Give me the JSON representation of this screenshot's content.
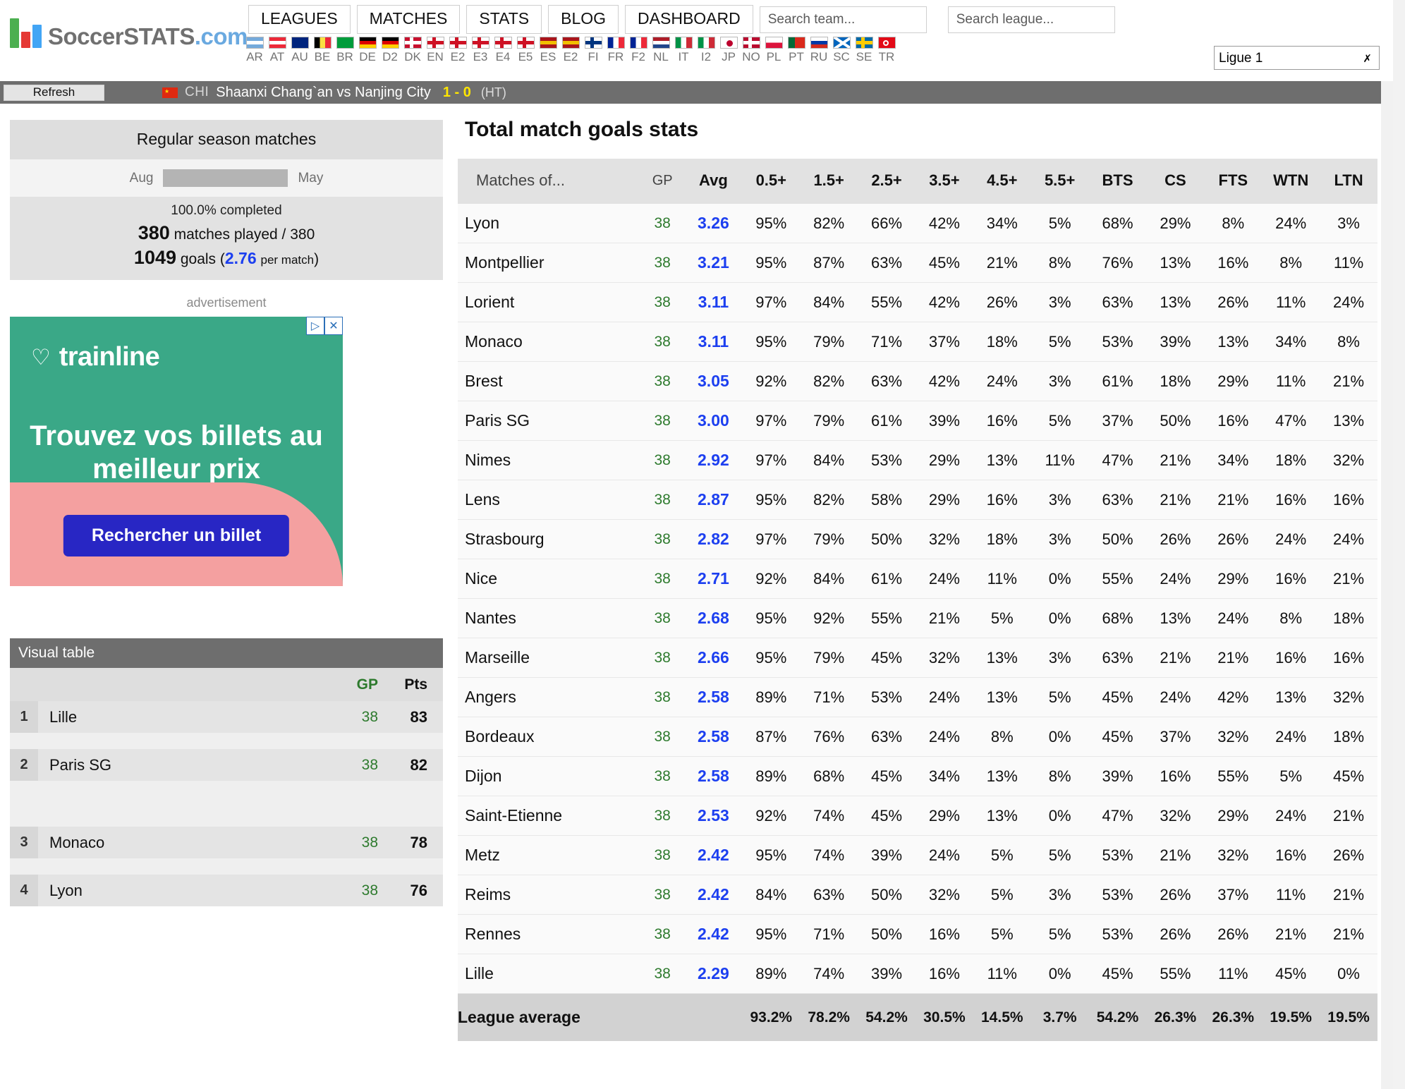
{
  "site": {
    "name_main": "SoccerSTATS",
    "name_suffix": ".com"
  },
  "nav": {
    "buttons": [
      "LEAGUES",
      "MATCHES",
      "STATS",
      "BLOG",
      "DASHBOARD"
    ],
    "search_team_placeholder": "Search team...",
    "search_league_placeholder": "Search league...",
    "search_team_value": "",
    "search_league_value": "",
    "league_selected": "Ligue 1",
    "league_options": [
      "Ligue 1"
    ]
  },
  "flags": [
    {
      "code": "AR",
      "colors": [
        "#75aadb",
        "#ffffff",
        "#75aadb"
      ],
      "dir": "h"
    },
    {
      "code": "AT",
      "colors": [
        "#ed2939",
        "#ffffff",
        "#ed2939"
      ],
      "dir": "h"
    },
    {
      "code": "AU",
      "colors": [
        "#00247d",
        "#00247d",
        "#00247d"
      ],
      "dir": "h"
    },
    {
      "code": "BE",
      "colors": [
        "#000000",
        "#fae042",
        "#ed2939"
      ],
      "dir": "v"
    },
    {
      "code": "BR",
      "colors": [
        "#009c3b",
        "#009c3b",
        "#009c3b"
      ],
      "dir": "h"
    },
    {
      "code": "DE",
      "colors": [
        "#000000",
        "#dd0000",
        "#ffce00"
      ],
      "dir": "h"
    },
    {
      "code": "D2",
      "colors": [
        "#000000",
        "#dd0000",
        "#ffce00"
      ],
      "dir": "h"
    },
    {
      "code": "DK",
      "colors": [
        "#c8102e",
        "#ffffff",
        "#c8102e"
      ],
      "dir": "cross"
    },
    {
      "code": "EN",
      "colors": [
        "#ffffff",
        "#ce1124",
        "#ffffff"
      ],
      "dir": "cross"
    },
    {
      "code": "E2",
      "colors": [
        "#ffffff",
        "#ce1124",
        "#ffffff"
      ],
      "dir": "cross"
    },
    {
      "code": "E3",
      "colors": [
        "#ffffff",
        "#ce1124",
        "#ffffff"
      ],
      "dir": "cross"
    },
    {
      "code": "E4",
      "colors": [
        "#ffffff",
        "#ce1124",
        "#ffffff"
      ],
      "dir": "cross"
    },
    {
      "code": "E5",
      "colors": [
        "#ffffff",
        "#ce1124",
        "#ffffff"
      ],
      "dir": "cross"
    },
    {
      "code": "ES",
      "colors": [
        "#aa151b",
        "#f1bf00",
        "#aa151b"
      ],
      "dir": "h"
    },
    {
      "code": "E2",
      "colors": [
        "#aa151b",
        "#f1bf00",
        "#aa151b"
      ],
      "dir": "h"
    },
    {
      "code": "FI",
      "colors": [
        "#ffffff",
        "#003580",
        "#ffffff"
      ],
      "dir": "cross"
    },
    {
      "code": "FR",
      "colors": [
        "#002395",
        "#ffffff",
        "#ed2939"
      ],
      "dir": "v"
    },
    {
      "code": "F2",
      "colors": [
        "#002395",
        "#ffffff",
        "#ed2939"
      ],
      "dir": "v"
    },
    {
      "code": "NL",
      "colors": [
        "#ae1c28",
        "#ffffff",
        "#21468b"
      ],
      "dir": "h"
    },
    {
      "code": "IT",
      "colors": [
        "#009246",
        "#ffffff",
        "#ce2b37"
      ],
      "dir": "v"
    },
    {
      "code": "I2",
      "colors": [
        "#009246",
        "#ffffff",
        "#ce2b37"
      ],
      "dir": "v"
    },
    {
      "code": "JP",
      "colors": [
        "#ffffff",
        "#bc002d",
        "#ffffff"
      ],
      "dir": "circle"
    },
    {
      "code": "NO",
      "colors": [
        "#ba0c2f",
        "#ffffff",
        "#00205b"
      ],
      "dir": "cross"
    },
    {
      "code": "PL",
      "colors": [
        "#ffffff",
        "#ffffff",
        "#dc143c"
      ],
      "dir": "h2"
    },
    {
      "code": "PT",
      "colors": [
        "#046a38",
        "#da291c",
        "#da291c"
      ],
      "dir": "v2"
    },
    {
      "code": "RU",
      "colors": [
        "#ffffff",
        "#0039a6",
        "#d52b1e"
      ],
      "dir": "h"
    },
    {
      "code": "SC",
      "colors": [
        "#0065bd",
        "#ffffff",
        "#0065bd"
      ],
      "dir": "saltire"
    },
    {
      "code": "SE",
      "colors": [
        "#006aa7",
        "#fecc00",
        "#006aa7"
      ],
      "dir": "cross"
    },
    {
      "code": "TR",
      "colors": [
        "#e30a17",
        "#ffffff",
        "#e30a17"
      ],
      "dir": "circle2"
    }
  ],
  "ticker": {
    "refresh_label": "Refresh",
    "country_code": "CHI",
    "match": "Shaanxi Chang`an vs Nanjing City",
    "score": "1 - 0",
    "period": "(HT)"
  },
  "season": {
    "title": "Regular season matches",
    "start_month": "Aug",
    "end_month": "May",
    "completed": "100.0% completed",
    "matches_played": "380",
    "matches_played_label": "matches played /",
    "matches_total": "380",
    "goals": "1049",
    "goals_label": "goals (",
    "goals_per_match": "2.76",
    "goals_per_match_label": "per match",
    "goals_close": ")"
  },
  "advert": {
    "label": "advertisement",
    "brand": "trainline",
    "headline": "Trouvez vos billets au meilleur prix",
    "cta": "Rechercher un billet",
    "info_icon": "▷",
    "close_icon": "✕"
  },
  "visual_table": {
    "title": "Visual table",
    "columns": {
      "gp": "GP",
      "pts": "Pts"
    },
    "rows": [
      {
        "rank": "1",
        "team": "Lille",
        "gp": "38",
        "pts": "83"
      },
      {
        "rank": "2",
        "team": "Paris SG",
        "gp": "38",
        "pts": "82"
      },
      {
        "rank": "3",
        "team": "Monaco",
        "gp": "38",
        "pts": "78"
      },
      {
        "rank": "4",
        "team": "Lyon",
        "gp": "38",
        "pts": "76"
      }
    ]
  },
  "main": {
    "title": "Total match goals stats",
    "columns": [
      "Matches of...",
      "GP",
      "Avg",
      "0.5+",
      "1.5+",
      "2.5+",
      "3.5+",
      "4.5+",
      "5.5+",
      "BTS",
      "CS",
      "FTS",
      "WTN",
      "LTN"
    ],
    "average_label": "League average"
  },
  "chart_data": {
    "type": "table",
    "title": "Total match goals stats",
    "columns": [
      "Matches of...",
      "GP",
      "Avg",
      "0.5+",
      "1.5+",
      "2.5+",
      "3.5+",
      "4.5+",
      "5.5+",
      "BTS",
      "CS",
      "FTS",
      "WTN",
      "LTN"
    ],
    "rows": [
      [
        "Lyon",
        "38",
        "3.26",
        "95%",
        "82%",
        "66%",
        "42%",
        "34%",
        "5%",
        "68%",
        "29%",
        "8%",
        "24%",
        "3%"
      ],
      [
        "Montpellier",
        "38",
        "3.21",
        "95%",
        "87%",
        "63%",
        "45%",
        "21%",
        "8%",
        "76%",
        "13%",
        "16%",
        "8%",
        "11%"
      ],
      [
        "Lorient",
        "38",
        "3.11",
        "97%",
        "84%",
        "55%",
        "42%",
        "26%",
        "3%",
        "63%",
        "13%",
        "26%",
        "11%",
        "24%"
      ],
      [
        "Monaco",
        "38",
        "3.11",
        "95%",
        "79%",
        "71%",
        "37%",
        "18%",
        "5%",
        "53%",
        "39%",
        "13%",
        "34%",
        "8%"
      ],
      [
        "Brest",
        "38",
        "3.05",
        "92%",
        "82%",
        "63%",
        "42%",
        "24%",
        "3%",
        "61%",
        "18%",
        "29%",
        "11%",
        "21%"
      ],
      [
        "Paris SG",
        "38",
        "3.00",
        "97%",
        "79%",
        "61%",
        "39%",
        "16%",
        "5%",
        "37%",
        "50%",
        "16%",
        "47%",
        "13%"
      ],
      [
        "Nimes",
        "38",
        "2.92",
        "97%",
        "84%",
        "53%",
        "29%",
        "13%",
        "11%",
        "47%",
        "21%",
        "34%",
        "18%",
        "32%"
      ],
      [
        "Lens",
        "38",
        "2.87",
        "95%",
        "82%",
        "58%",
        "29%",
        "16%",
        "3%",
        "63%",
        "21%",
        "21%",
        "16%",
        "16%"
      ],
      [
        "Strasbourg",
        "38",
        "2.82",
        "97%",
        "79%",
        "50%",
        "32%",
        "18%",
        "3%",
        "50%",
        "26%",
        "26%",
        "24%",
        "24%"
      ],
      [
        "Nice",
        "38",
        "2.71",
        "92%",
        "84%",
        "61%",
        "24%",
        "11%",
        "0%",
        "55%",
        "24%",
        "29%",
        "16%",
        "21%"
      ],
      [
        "Nantes",
        "38",
        "2.68",
        "95%",
        "92%",
        "55%",
        "21%",
        "5%",
        "0%",
        "68%",
        "13%",
        "24%",
        "8%",
        "18%"
      ],
      [
        "Marseille",
        "38",
        "2.66",
        "95%",
        "79%",
        "45%",
        "32%",
        "13%",
        "3%",
        "63%",
        "21%",
        "21%",
        "16%",
        "16%"
      ],
      [
        "Angers",
        "38",
        "2.58",
        "89%",
        "71%",
        "53%",
        "24%",
        "13%",
        "5%",
        "45%",
        "24%",
        "42%",
        "13%",
        "32%"
      ],
      [
        "Bordeaux",
        "38",
        "2.58",
        "87%",
        "76%",
        "63%",
        "24%",
        "8%",
        "0%",
        "45%",
        "37%",
        "32%",
        "24%",
        "18%"
      ],
      [
        "Dijon",
        "38",
        "2.58",
        "89%",
        "68%",
        "45%",
        "34%",
        "13%",
        "8%",
        "39%",
        "16%",
        "55%",
        "5%",
        "45%"
      ],
      [
        "Saint-Etienne",
        "38",
        "2.53",
        "92%",
        "74%",
        "45%",
        "29%",
        "13%",
        "0%",
        "47%",
        "32%",
        "29%",
        "24%",
        "21%"
      ],
      [
        "Metz",
        "38",
        "2.42",
        "95%",
        "74%",
        "39%",
        "24%",
        "5%",
        "5%",
        "53%",
        "21%",
        "32%",
        "16%",
        "26%"
      ],
      [
        "Reims",
        "38",
        "2.42",
        "84%",
        "63%",
        "50%",
        "32%",
        "5%",
        "3%",
        "53%",
        "26%",
        "37%",
        "11%",
        "21%"
      ],
      [
        "Rennes",
        "38",
        "2.42",
        "95%",
        "71%",
        "50%",
        "16%",
        "5%",
        "5%",
        "53%",
        "26%",
        "26%",
        "21%",
        "21%"
      ],
      [
        "Lille",
        "38",
        "2.29",
        "89%",
        "74%",
        "39%",
        "16%",
        "11%",
        "0%",
        "45%",
        "55%",
        "11%",
        "45%",
        "0%"
      ]
    ],
    "average_row": [
      "League average",
      "",
      "",
      "93.2%",
      "78.2%",
      "54.2%",
      "30.5%",
      "14.5%",
      "3.7%",
      "54.2%",
      "26.3%",
      "26.3%",
      "19.5%",
      "19.5%"
    ]
  }
}
